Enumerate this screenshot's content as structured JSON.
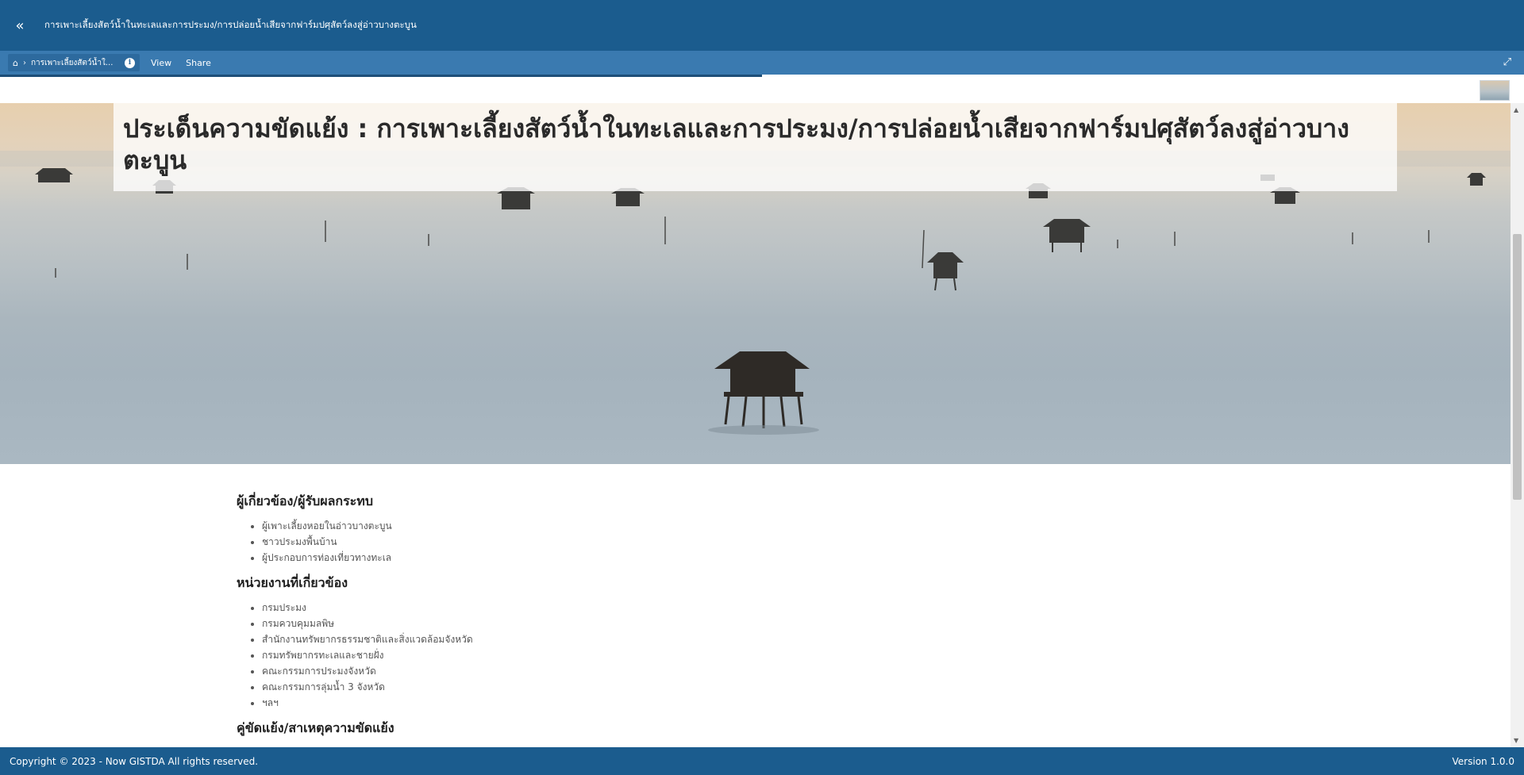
{
  "header": {
    "back_icon": "double-chevron-left-icon",
    "title": "การเพาะเลี้ยงสัตว์น้ำในทะเลและการประมง/การปล่อยน้ำเสียจากฟาร์มปศุสัตว์ลงสู่อ่าวบางตะบูน"
  },
  "nav": {
    "home_icon": "home-icon",
    "breadcrumb": "การเพาะเลี้ยงสัตว์น้ำใ...",
    "info_icon": "info-icon",
    "view_label": "View",
    "share_label": "Share",
    "expand_icon": "expand-icon"
  },
  "hero": {
    "title": "ประเด็นความขัดแย้ง : การเพาะเลี้ยงสัตว์น้ำในทะเลและการประมง/การปล่อยน้ำเสียจากฟาร์มปศุสัตว์ลงสู่อ่าวบางตะบูน"
  },
  "sections": [
    {
      "heading": "ผู้เกี่ยวข้อง/ผู้รับผลกระทบ",
      "items": [
        "ผู้เพาะเลี้ยงหอยในอ่าวบางตะบูน",
        "ชาวประมงพื้นบ้าน",
        "ผู้ประกอบการท่องเที่ยวทางทะเล"
      ]
    },
    {
      "heading": "หน่วยงานที่เกี่ยวข้อง",
      "items": [
        "กรมประมง",
        "กรมควบคุมมลพิษ",
        "สำนักงานทรัพยากรธรรมชาติและสิ่งแวดล้อมจังหวัด",
        "กรมทรัพยากรทะเลและชายฝั่ง",
        "คณะกรรมการประมงจังหวัด",
        "คณะกรรมการลุ่มน้ำ 3 จังหวัด",
        "ฯลฯ"
      ]
    },
    {
      "heading": "คู่ขัดแย้ง/สาเหตุความขัดแย้ง",
      "items": []
    }
  ],
  "footer": {
    "copyright": "Copyright © 2023 - Now GISTDA All rights reserved.",
    "version": "Version 1.0.0"
  }
}
